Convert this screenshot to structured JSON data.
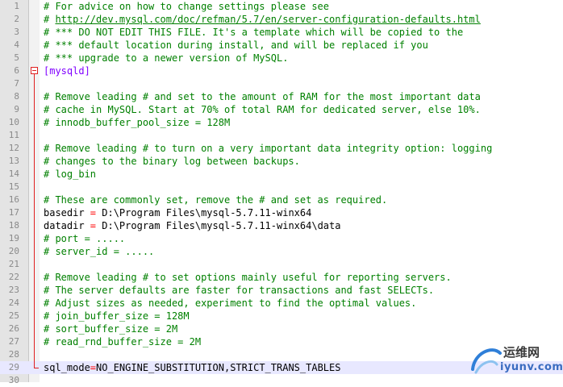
{
  "editor": {
    "language": "ini",
    "folded_section": "[mysqld]",
    "current_line": 29,
    "lines": [
      {
        "n": "1",
        "segments": [
          {
            "t": "# For advice on how to change settings please see",
            "k": "comment"
          }
        ]
      },
      {
        "n": "2",
        "segments": [
          {
            "t": "# ",
            "k": "comment"
          },
          {
            "t": "http://dev.mysql.com/doc/refman/5.7/en/server-configuration-defaults.html",
            "k": "link"
          }
        ]
      },
      {
        "n": "3",
        "segments": [
          {
            "t": "# *** DO NOT EDIT THIS FILE. It's a template which will be copied to the",
            "k": "comment"
          }
        ]
      },
      {
        "n": "4",
        "segments": [
          {
            "t": "# *** default location during install, and will be replaced if you",
            "k": "comment"
          }
        ]
      },
      {
        "n": "5",
        "segments": [
          {
            "t": "# *** upgrade to a newer version of MySQL.",
            "k": "comment"
          }
        ]
      },
      {
        "n": "6",
        "segments": [
          {
            "t": "[mysqld]",
            "k": "section"
          }
        ]
      },
      {
        "n": "7",
        "segments": []
      },
      {
        "n": "8",
        "segments": [
          {
            "t": "# Remove leading # and set to the amount of RAM for the most important data",
            "k": "comment"
          }
        ]
      },
      {
        "n": "9",
        "segments": [
          {
            "t": "# cache in MySQL. Start at 70% of total RAM for dedicated server, else 10%.",
            "k": "comment"
          }
        ]
      },
      {
        "n": "10",
        "segments": [
          {
            "t": "# innodb_buffer_pool_size = 128M",
            "k": "comment"
          }
        ]
      },
      {
        "n": "11",
        "segments": []
      },
      {
        "n": "12",
        "segments": [
          {
            "t": "# Remove leading # to turn on a very important data integrity option: logging",
            "k": "comment"
          }
        ]
      },
      {
        "n": "13",
        "segments": [
          {
            "t": "# changes to the binary log between backups.",
            "k": "comment"
          }
        ]
      },
      {
        "n": "14",
        "segments": [
          {
            "t": "# log_bin",
            "k": "comment"
          }
        ]
      },
      {
        "n": "15",
        "segments": []
      },
      {
        "n": "16",
        "segments": [
          {
            "t": "# These are commonly set, remove the # and set as required.",
            "k": "comment"
          }
        ]
      },
      {
        "n": "17",
        "segments": [
          {
            "t": "basedir ",
            "k": "key"
          },
          {
            "t": "=",
            "k": "op"
          },
          {
            "t": " D:\\Program Files\\mysql-5.7.11-winx64",
            "k": "val"
          }
        ]
      },
      {
        "n": "18",
        "segments": [
          {
            "t": "datadir ",
            "k": "key"
          },
          {
            "t": "=",
            "k": "op"
          },
          {
            "t": " D:\\Program Files\\mysql-5.7.11-winx64\\data",
            "k": "val"
          }
        ]
      },
      {
        "n": "19",
        "segments": [
          {
            "t": "# port = .....",
            "k": "comment"
          }
        ]
      },
      {
        "n": "20",
        "segments": [
          {
            "t": "# server_id = .....",
            "k": "comment"
          }
        ]
      },
      {
        "n": "21",
        "segments": []
      },
      {
        "n": "22",
        "segments": [
          {
            "t": "# Remove leading # to set options mainly useful for reporting servers.",
            "k": "comment"
          }
        ]
      },
      {
        "n": "23",
        "segments": [
          {
            "t": "# The server defaults are faster for transactions and fast SELECTs.",
            "k": "comment"
          }
        ]
      },
      {
        "n": "24",
        "segments": [
          {
            "t": "# Adjust sizes as needed, experiment to find the optimal values.",
            "k": "comment"
          }
        ]
      },
      {
        "n": "25",
        "segments": [
          {
            "t": "# join_buffer_size = 128M",
            "k": "comment"
          }
        ]
      },
      {
        "n": "26",
        "segments": [
          {
            "t": "# sort_buffer_size = 2M",
            "k": "comment"
          }
        ]
      },
      {
        "n": "27",
        "segments": [
          {
            "t": "# read_rnd_buffer_size = 2M",
            "k": "comment"
          }
        ]
      },
      {
        "n": "28",
        "segments": []
      },
      {
        "n": "29",
        "segments": [
          {
            "t": "sql_mode",
            "k": "key"
          },
          {
            "t": "=",
            "k": "op"
          },
          {
            "t": "NO_ENGINE_SUBSTITUTION,STRICT_TRANS_TABLES",
            "k": "val"
          }
        ]
      },
      {
        "n": "30",
        "segments": []
      }
    ]
  },
  "watermark": {
    "title": "运维网",
    "domain": "iyunv.com"
  },
  "colors": {
    "comment": "#008000",
    "section": "#8000ff",
    "operator": "#ff0000",
    "current_line": "#e8e8ff",
    "gutter": "#e4e4e4"
  }
}
